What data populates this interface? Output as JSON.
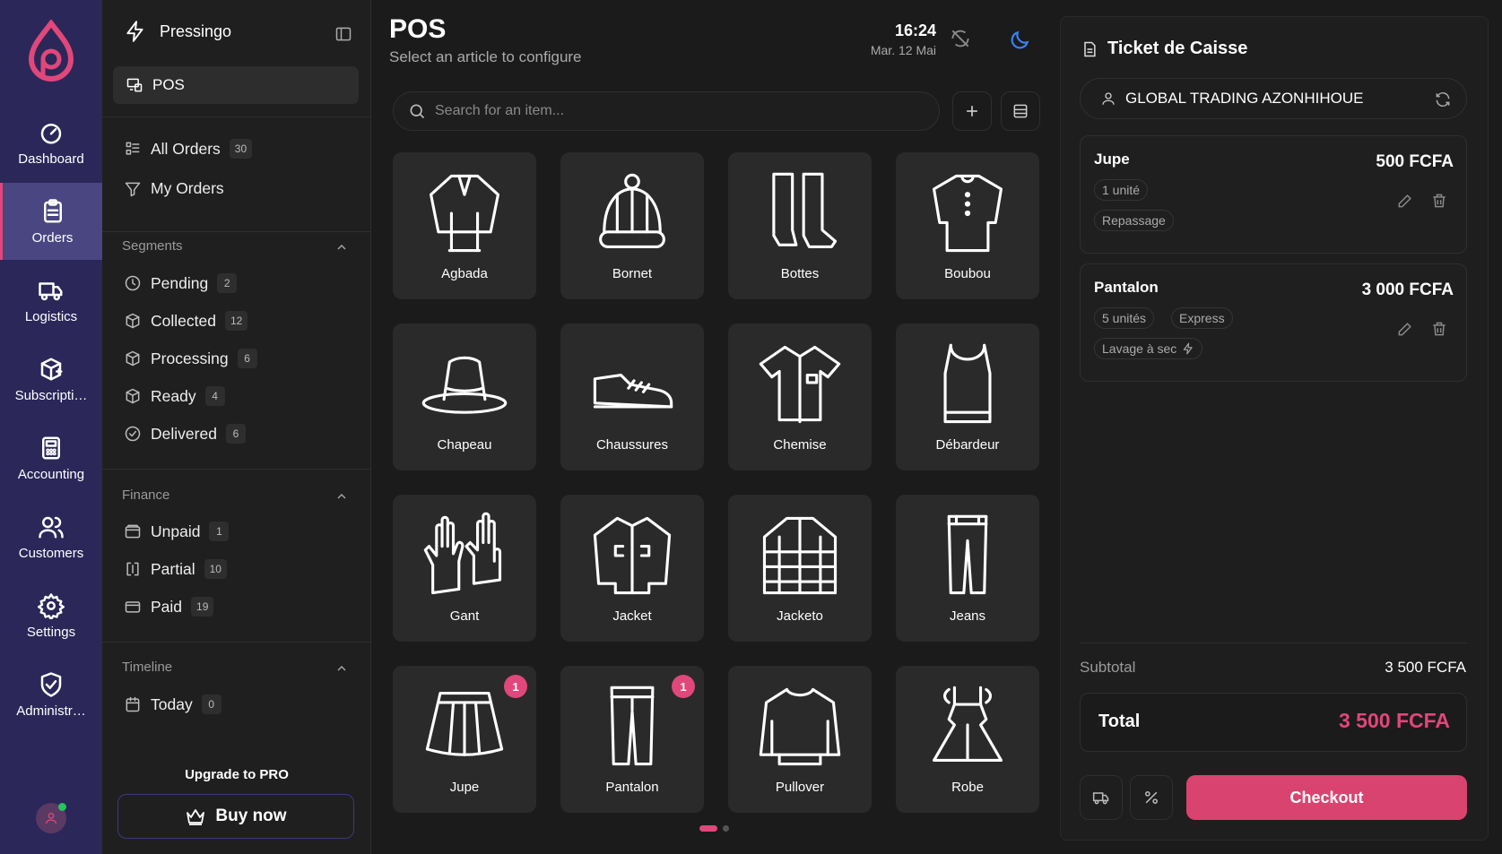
{
  "rail": {
    "items": [
      {
        "label": "Dashboard",
        "icon": "gauge-icon"
      },
      {
        "label": "Orders",
        "icon": "clipboard-icon"
      },
      {
        "label": "Logistics",
        "icon": "truck-icon"
      },
      {
        "label": "Subscripti…",
        "icon": "package-plus-icon"
      },
      {
        "label": "Accounting",
        "icon": "calculator-icon"
      },
      {
        "label": "Customers",
        "icon": "users-icon"
      },
      {
        "label": "Settings",
        "icon": "gear-icon"
      },
      {
        "label": "Administr…",
        "icon": "shield-check-icon"
      }
    ],
    "active": "Orders"
  },
  "sidebar": {
    "brand": "Pressingo",
    "pos_label": "POS",
    "orders": [
      {
        "label": "All Orders",
        "count": "30"
      },
      {
        "label": "My Orders",
        "count": ""
      }
    ],
    "segments_title": "Segments",
    "segments": [
      {
        "label": "Pending",
        "count": "2"
      },
      {
        "label": "Collected",
        "count": "12"
      },
      {
        "label": "Processing",
        "count": "6"
      },
      {
        "label": "Ready",
        "count": "4"
      },
      {
        "label": "Delivered",
        "count": "6"
      }
    ],
    "finance_title": "Finance",
    "finance": [
      {
        "label": "Unpaid",
        "count": "1"
      },
      {
        "label": "Partial",
        "count": "10"
      },
      {
        "label": "Paid",
        "count": "19"
      }
    ],
    "timeline_title": "Timeline",
    "timeline": [
      {
        "label": "Today",
        "count": "0"
      }
    ],
    "upgrade": "Upgrade to PRO",
    "buy": "Buy now"
  },
  "main": {
    "title": "POS",
    "subtitle": "Select an article to configure",
    "time": "16:24",
    "date": "Mar. 12 Mai",
    "search_placeholder": "Search for an item...",
    "items": [
      {
        "label": "Agbada",
        "icon": "agbada-icon",
        "count": ""
      },
      {
        "label": "Bornet",
        "icon": "beanie-icon",
        "count": ""
      },
      {
        "label": "Bottes",
        "icon": "boots-icon",
        "count": ""
      },
      {
        "label": "Boubou",
        "icon": "boubou-icon",
        "count": ""
      },
      {
        "label": "Chapeau",
        "icon": "hat-icon",
        "count": ""
      },
      {
        "label": "Chaussures",
        "icon": "sneaker-icon",
        "count": ""
      },
      {
        "label": "Chemise",
        "icon": "shirt-icon",
        "count": ""
      },
      {
        "label": "Débardeur",
        "icon": "tank-top-icon",
        "count": ""
      },
      {
        "label": "Gant",
        "icon": "gloves-icon",
        "count": ""
      },
      {
        "label": "Jacket",
        "icon": "jacket-icon",
        "count": ""
      },
      {
        "label": "Jacketo",
        "icon": "puffer-jacket-icon",
        "count": ""
      },
      {
        "label": "Jeans",
        "icon": "jeans-icon",
        "count": ""
      },
      {
        "label": "Jupe",
        "icon": "skirt-icon",
        "count": "1"
      },
      {
        "label": "Pantalon",
        "icon": "trousers-icon",
        "count": "1"
      },
      {
        "label": "Pullover",
        "icon": "sweater-icon",
        "count": ""
      },
      {
        "label": "Robe",
        "icon": "dress-icon",
        "count": ""
      }
    ]
  },
  "ticket": {
    "title": "Ticket de Caisse",
    "client": "GLOBAL TRADING AZONHIHOUE",
    "lines": [
      {
        "name": "Jupe",
        "price": "500 FCFA",
        "chips": [
          "1 unité"
        ],
        "service": "Repassage",
        "express_icon": false
      },
      {
        "name": "Pantalon",
        "price": "3 000 FCFA",
        "chips": [
          "5 unités",
          "Express"
        ],
        "service": "Lavage à sec",
        "express_icon": true
      }
    ],
    "subtotal_label": "Subtotal",
    "subtotal": "3 500 FCFA",
    "total_label": "Total",
    "total": "3 500 FCFA",
    "checkout": "Checkout"
  },
  "colors": {
    "accent": "#e0477a",
    "rail": "#2b2759",
    "bg": "#1b1b1b",
    "card": "#2a2a2a"
  }
}
